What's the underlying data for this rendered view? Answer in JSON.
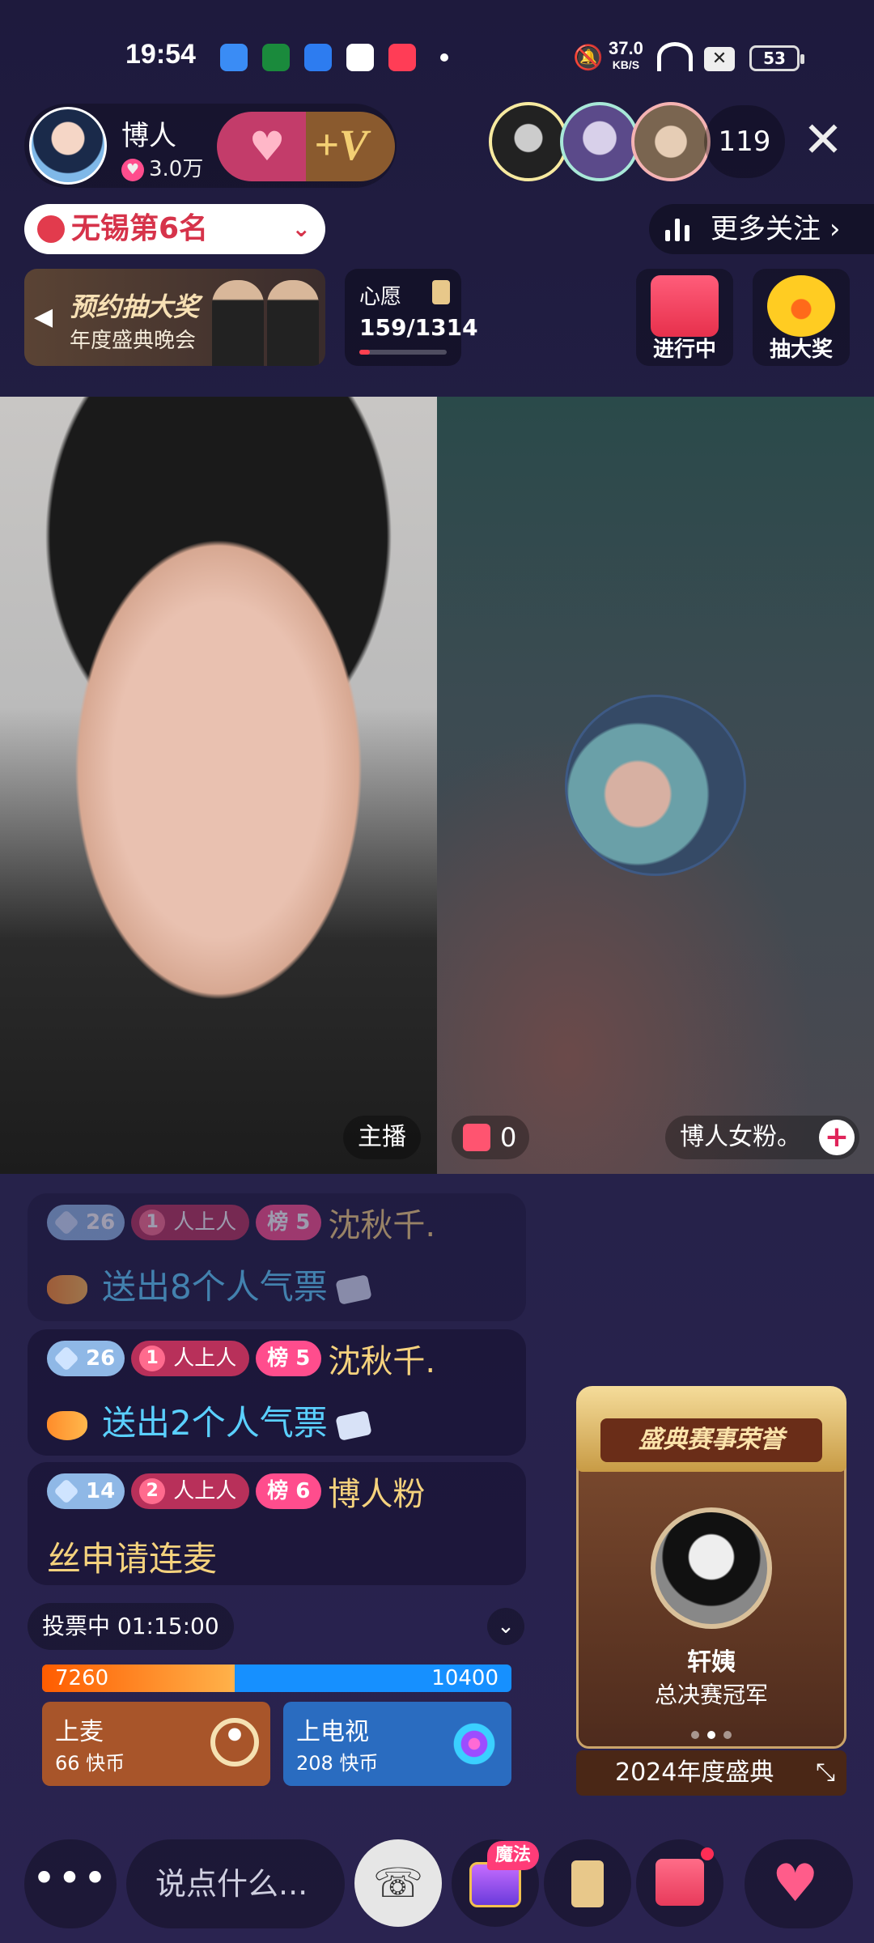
{
  "status_bar": {
    "time": "19:54",
    "net_speed": "37.0",
    "net_unit": "KB/S",
    "battery": "53",
    "app_icons": [
      "blue-app-icon",
      "oppo-icon",
      "folder-icon",
      "search-app-icon",
      "music-icon"
    ]
  },
  "header": {
    "streamer_name": "博人",
    "likes": "3.0万",
    "viewer_count": "119"
  },
  "rank": {
    "label": "无锡第6名",
    "more_follow": "更多关注"
  },
  "promo": {
    "title": "预约抽大奖",
    "subtitle": "年度盛典晚会"
  },
  "wish": {
    "label": "心愿",
    "progress": "159/1314",
    "progress_fraction": 0.121
  },
  "activities": [
    {
      "label": "进行中"
    },
    {
      "label": "抽大奖"
    }
  ],
  "video": {
    "host_tag": "主播",
    "gift_count": "0",
    "guest_name": "博人女粉。"
  },
  "chat": [
    {
      "level": "26",
      "fan_level": "1",
      "fan_club": "人上人",
      "rank": "榜 5",
      "user": "沈秋千.",
      "text": "送出8个人气票"
    },
    {
      "level": "26",
      "fan_level": "1",
      "fan_club": "人上人",
      "rank": "榜 5",
      "user": "沈秋千.",
      "text": "送出2个人气票"
    },
    {
      "level": "14",
      "fan_level": "2",
      "fan_club": "人上人",
      "rank": "榜 6",
      "user": "博人粉",
      "text": "丝申请连麦"
    }
  ],
  "vote": {
    "status": "投票中 01:15:00",
    "left_value": "7260",
    "right_value": "10400",
    "left_share": 0.411,
    "options": [
      {
        "title": "上麦",
        "cost": "66 快币"
      },
      {
        "title": "上电视",
        "cost": "208 快币"
      }
    ]
  },
  "honor": {
    "title": "盛典赛事荣誉",
    "name": "轩姨",
    "subtitle": "总决赛冠军",
    "footer": "2024年度盛典",
    "active_page": 2,
    "total_pages": 3
  },
  "bottom_bar": {
    "more": "•••",
    "input_placeholder": "说点什么...",
    "magic_badge": "魔法"
  },
  "colors": {
    "accent_pink": "#ff4d8d",
    "user_gold": "#f5d27d",
    "gift_text_cyan": "#5ad0ff",
    "vote_orange": "#ff5c00",
    "vote_blue": "#1690ff"
  }
}
